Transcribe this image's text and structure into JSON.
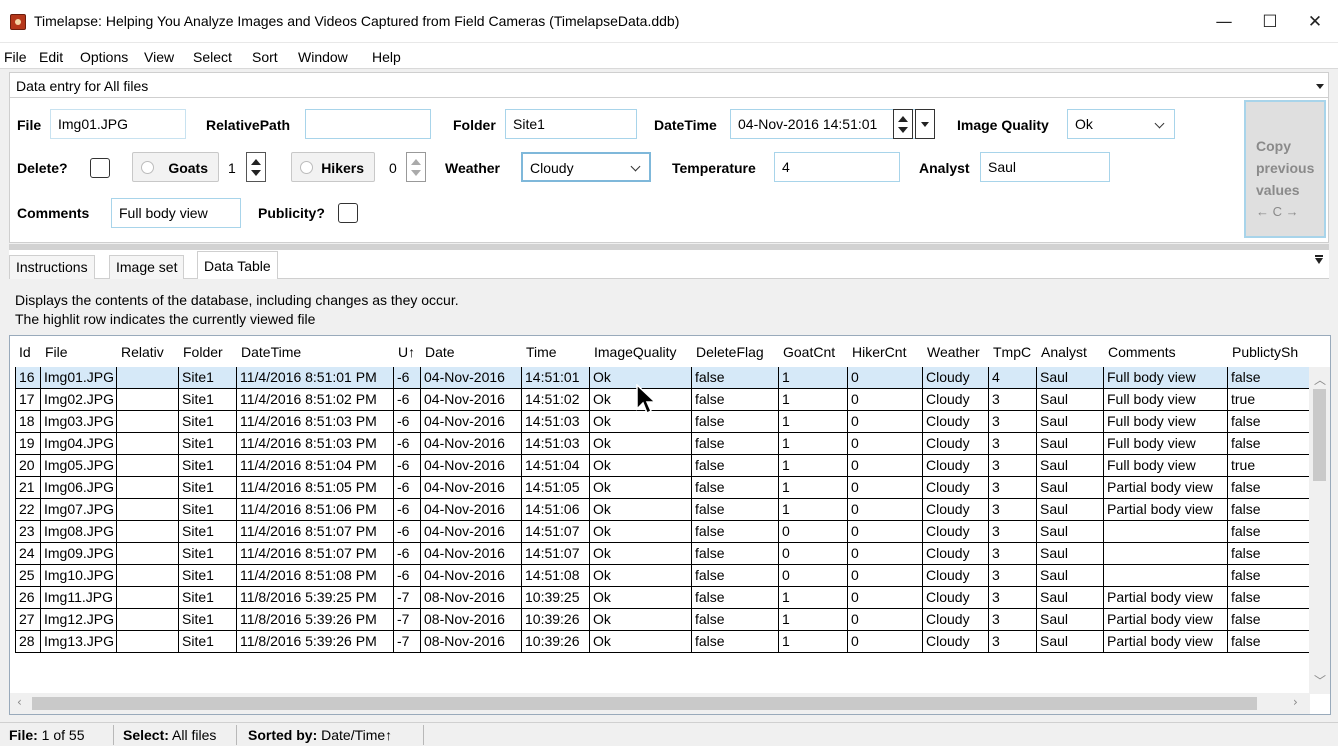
{
  "window": {
    "title": "Timelapse: Helping You Analyze Images and Videos Captured from Field Cameras (TimelapseData.ddb)",
    "minimize_glyph": "—",
    "maximize_glyph": "☐",
    "close_glyph": "✕"
  },
  "menu": [
    "File",
    "Edit",
    "Options",
    "View",
    "Select",
    "Sort",
    "Window",
    "Help"
  ],
  "data_entry": {
    "header": "Data entry for All files",
    "file_label": "File",
    "file_value": "Img01.JPG",
    "relpath_label": "RelativePath",
    "relpath_value": "",
    "folder_label": "Folder",
    "folder_value": "Site1",
    "datetime_label": "DateTime",
    "datetime_value": "04-Nov-2016 14:51:01",
    "quality_label": "Image Quality",
    "quality_value": "Ok",
    "delete_label": "Delete?",
    "goats_label": "Goats",
    "goats_value": "1",
    "hikers_label": "Hikers",
    "hikers_value": "0",
    "weather_label": "Weather",
    "weather_value": "Cloudy",
    "temp_label": "Temperature",
    "temp_value": "4",
    "analyst_label": "Analyst",
    "analyst_value": "Saul",
    "comments_label": "Comments",
    "comments_value": "Full body view",
    "publicity_label": "Publicity?",
    "copy_line1": "Copy",
    "copy_line2": "previous",
    "copy_line3": "values",
    "copy_arrows": "← C →"
  },
  "tabs": [
    "Instructions",
    "Image set",
    "Data Table"
  ],
  "active_tab": "Data Table",
  "description": [
    "Displays the contents of the database, including changes as they occur.",
    "The highlit row indicates the currently viewed file"
  ],
  "table": {
    "columns": [
      "Id",
      "File",
      "Relativ",
      "Folder",
      "DateTime",
      "U↑",
      "Date",
      "Time",
      "ImageQuality",
      "DeleteFlag",
      "GoatCnt",
      "HikerCnt",
      "Weather",
      "TmpC",
      "Analyst",
      "Comments",
      "PublictySh"
    ],
    "rows": [
      [
        "16",
        "Img01.JPG",
        "",
        "Site1",
        "11/4/2016 8:51:01 PM",
        "-6",
        "04-Nov-2016",
        "14:51:01",
        "Ok",
        "false",
        "1",
        "0",
        "Cloudy",
        "4",
        "Saul",
        "Full body view",
        "false"
      ],
      [
        "17",
        "Img02.JPG",
        "",
        "Site1",
        "11/4/2016 8:51:02 PM",
        "-6",
        "04-Nov-2016",
        "14:51:02",
        "Ok",
        "false",
        "1",
        "0",
        "Cloudy",
        "3",
        "Saul",
        "Full body view",
        "true"
      ],
      [
        "18",
        "Img03.JPG",
        "",
        "Site1",
        "11/4/2016 8:51:03 PM",
        "-6",
        "04-Nov-2016",
        "14:51:03",
        "Ok",
        "false",
        "1",
        "0",
        "Cloudy",
        "3",
        "Saul",
        "Full body view",
        "false"
      ],
      [
        "19",
        "Img04.JPG",
        "",
        "Site1",
        "11/4/2016 8:51:03 PM",
        "-6",
        "04-Nov-2016",
        "14:51:03",
        "Ok",
        "false",
        "1",
        "0",
        "Cloudy",
        "3",
        "Saul",
        "Full body view",
        "false"
      ],
      [
        "20",
        "Img05.JPG",
        "",
        "Site1",
        "11/4/2016 8:51:04 PM",
        "-6",
        "04-Nov-2016",
        "14:51:04",
        "Ok",
        "false",
        "1",
        "0",
        "Cloudy",
        "3",
        "Saul",
        "Full body view",
        "true"
      ],
      [
        "21",
        "Img06.JPG",
        "",
        "Site1",
        "11/4/2016 8:51:05 PM",
        "-6",
        "04-Nov-2016",
        "14:51:05",
        "Ok",
        "false",
        "1",
        "0",
        "Cloudy",
        "3",
        "Saul",
        "Partial body view",
        "false"
      ],
      [
        "22",
        "Img07.JPG",
        "",
        "Site1",
        "11/4/2016 8:51:06 PM",
        "-6",
        "04-Nov-2016",
        "14:51:06",
        "Ok",
        "false",
        "1",
        "0",
        "Cloudy",
        "3",
        "Saul",
        "Partial body view",
        "false"
      ],
      [
        "23",
        "Img08.JPG",
        "",
        "Site1",
        "11/4/2016 8:51:07 PM",
        "-6",
        "04-Nov-2016",
        "14:51:07",
        "Ok",
        "false",
        "0",
        "0",
        "Cloudy",
        "3",
        "Saul",
        "",
        "false"
      ],
      [
        "24",
        "Img09.JPG",
        "",
        "Site1",
        "11/4/2016 8:51:07 PM",
        "-6",
        "04-Nov-2016",
        "14:51:07",
        "Ok",
        "false",
        "0",
        "0",
        "Cloudy",
        "3",
        "Saul",
        "",
        "false"
      ],
      [
        "25",
        "Img10.JPG",
        "",
        "Site1",
        "11/4/2016 8:51:08 PM",
        "-6",
        "04-Nov-2016",
        "14:51:08",
        "Ok",
        "false",
        "0",
        "0",
        "Cloudy",
        "3",
        "Saul",
        "",
        "false"
      ],
      [
        "26",
        "Img11.JPG",
        "",
        "Site1",
        "11/8/2016 5:39:25 PM",
        "-7",
        "08-Nov-2016",
        "10:39:25",
        "Ok",
        "false",
        "1",
        "0",
        "Cloudy",
        "3",
        "Saul",
        "Partial body view",
        "false"
      ],
      [
        "27",
        "Img12.JPG",
        "",
        "Site1",
        "11/8/2016 5:39:26 PM",
        "-7",
        "08-Nov-2016",
        "10:39:26",
        "Ok",
        "false",
        "1",
        "0",
        "Cloudy",
        "3",
        "Saul",
        "Partial body view",
        "false"
      ],
      [
        "28",
        "Img13.JPG",
        "",
        "Site1",
        "11/8/2016 5:39:26 PM",
        "-7",
        "08-Nov-2016",
        "10:39:26",
        "Ok",
        "false",
        "1",
        "0",
        "Cloudy",
        "3",
        "Saul",
        "Partial body view",
        "false"
      ]
    ]
  },
  "status": {
    "file_label": "File:",
    "file_value": "1 of 55",
    "select_label": "Select:",
    "select_value": "All files",
    "sorted_label": "Sorted by:",
    "sorted_value": "Date/Time↑"
  }
}
